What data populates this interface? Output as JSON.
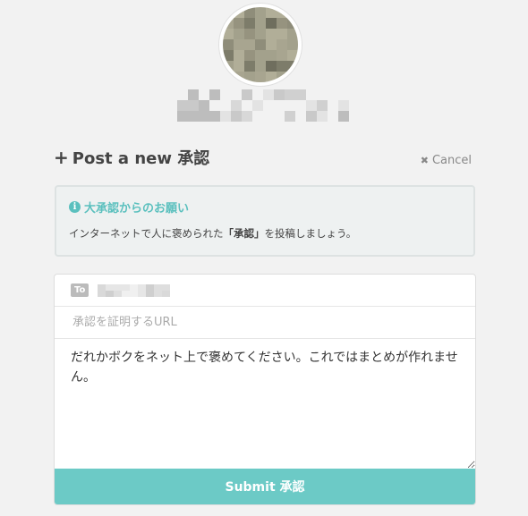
{
  "profile": {
    "avatar_icon": "pixelated-avatar"
  },
  "post": {
    "title": "Post a new 承認",
    "plus_icon": "plus-icon",
    "cancel_label": "Cancel"
  },
  "notice": {
    "title": "大承認からのお願い",
    "body_prefix": "インターネットで人に褒められた",
    "body_highlight": "「承認」",
    "body_suffix": "を投稿しましょう。"
  },
  "form": {
    "to_label": "To",
    "url_placeholder": "承認を証明するURL",
    "message_value": "だれかボクをネット上で褒めてください。これではまとめが作れません。",
    "submit_label": "Submit 承認"
  },
  "colors": {
    "accent": "#6ccac6",
    "notice_title": "#5bc0be"
  }
}
